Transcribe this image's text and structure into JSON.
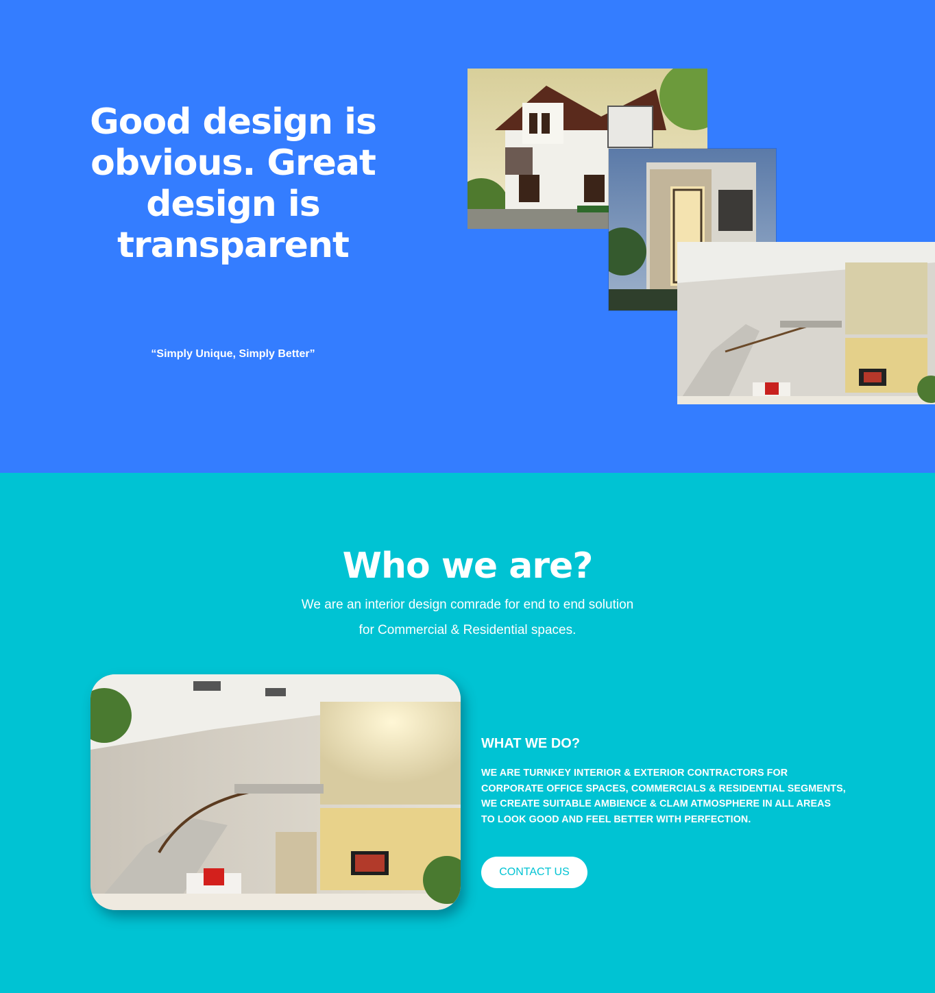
{
  "hero": {
    "title_lines": [
      "Good design is",
      "obvious. Great",
      "design is",
      "transparent"
    ],
    "tagline": "“Simply Unique, Simply Better”",
    "images": [
      "house-exterior-photo",
      "modern-villa-night-photo",
      "living-room-interior-photo"
    ]
  },
  "about": {
    "title": "Who we are?",
    "subtitle_line1": "We are an interior design comrade for end to end solution",
    "subtitle_line2": "for Commercial & Residential spaces.",
    "what_title": "WHAT WE DO?",
    "what_lines": [
      "WE ARE TURNKEY INTERIOR & EXTERIOR CONTRACTORS FOR",
      "CORPORATE OFFICE SPACES, COMMERCIALS & RESIDENTIAL SEGMENTS,",
      "WE CREATE SUITABLE AMBIENCE & CLAM ATMOSPHERE IN ALL AREAS",
      "TO LOOK GOOD AND FEEL BETTER WITH PERFECTION."
    ],
    "contact_label": "CONTACT US"
  },
  "colors": {
    "hero_bg": "#347dff",
    "about_bg": "#00c3d3",
    "button_text": "#00c3d3"
  }
}
